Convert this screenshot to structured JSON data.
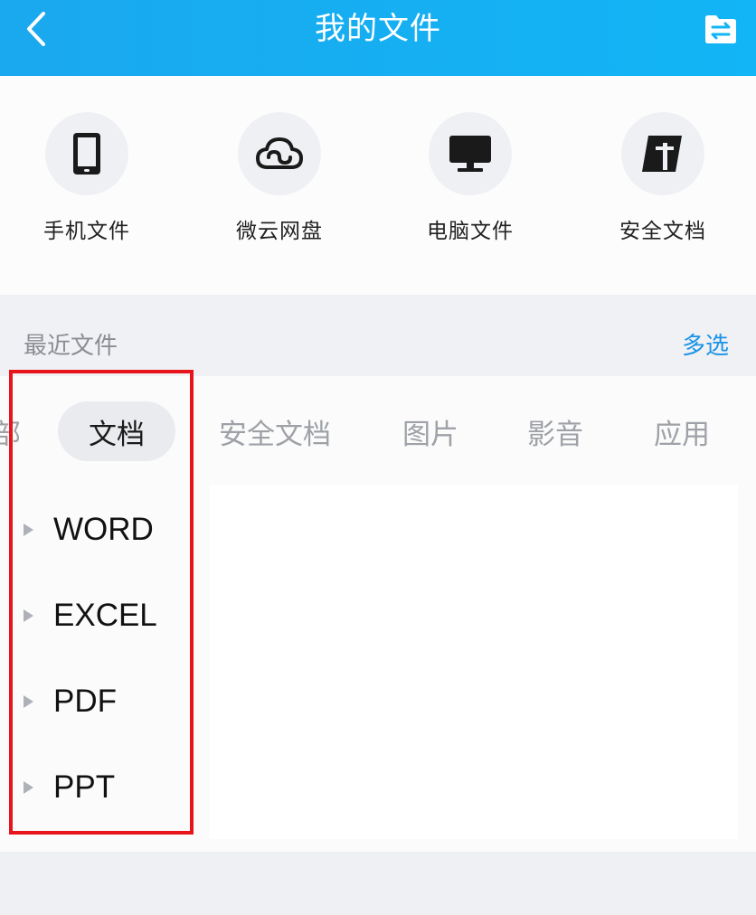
{
  "header": {
    "title": "我的文件"
  },
  "quick_access": [
    {
      "label": "手机文件",
      "icon": "phone-icon"
    },
    {
      "label": "微云网盘",
      "icon": "cloud-icon"
    },
    {
      "label": "电脑文件",
      "icon": "monitor-icon"
    },
    {
      "label": "安全文档",
      "icon": "secure-doc-icon"
    }
  ],
  "recent": {
    "title": "最近文件",
    "multi_select": "多选"
  },
  "tabs": [
    "部",
    "文档",
    "安全文档",
    "图片",
    "影音",
    "应用"
  ],
  "active_tab": "文档",
  "doc_types": [
    "WORD",
    "EXCEL",
    "PDF",
    "PPT"
  ],
  "colors": {
    "header": "#12b5f5",
    "accent": "#1a93e6",
    "highlight": "#e8141c"
  }
}
